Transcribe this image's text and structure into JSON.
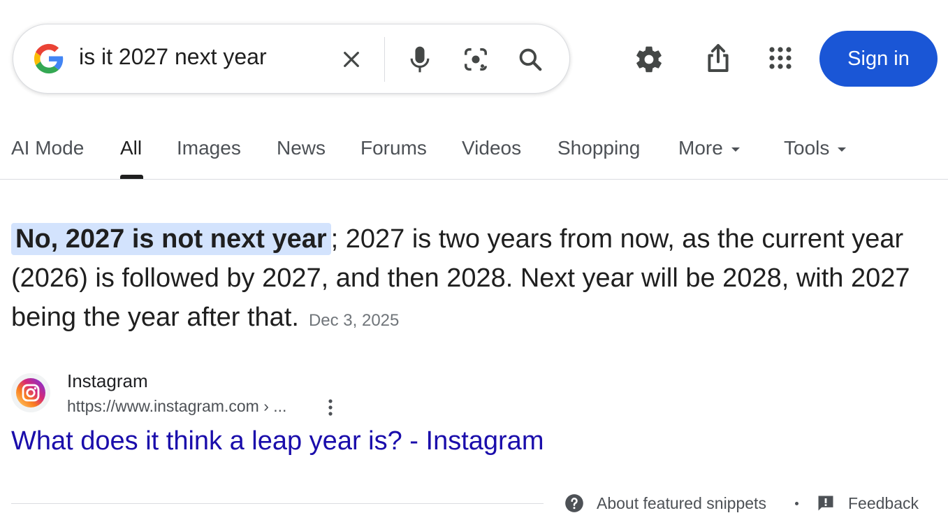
{
  "search": {
    "query": "is it 2027 next year",
    "icons": [
      "google-logo",
      "clear-icon",
      "mic-icon",
      "lens-icon",
      "search-icon"
    ]
  },
  "header": {
    "icons": [
      "gear-icon",
      "share-icon",
      "apps-grid-icon"
    ],
    "sign_in_label": "Sign in",
    "sign_in_color": "#1a56d6"
  },
  "tabs": [
    {
      "label": "AI Mode",
      "active": false
    },
    {
      "label": "All",
      "active": true
    },
    {
      "label": "Images",
      "active": false
    },
    {
      "label": "News",
      "active": false
    },
    {
      "label": "Forums",
      "active": false
    },
    {
      "label": "Videos",
      "active": false
    },
    {
      "label": "Shopping",
      "active": false
    },
    {
      "label": "More",
      "active": false,
      "dropdown": true
    },
    {
      "label": "Tools",
      "active": false,
      "dropdown": true
    }
  ],
  "snippet": {
    "highlight": "No, 2027 is not next year",
    "text": "; 2027 is two years from now, as the current year (2026) is followed by 2027, and then 2028. Next year will be 2028, with 2027 being the year after that.",
    "date": "Dec 3, 2025",
    "highlight_color": "#d3e3fd"
  },
  "source": {
    "name": "Instagram",
    "url": "https://www.instagram.com › ...",
    "title": "What does it think a leap year is? - Instagram",
    "title_color": "#1a0dab",
    "favicon": "instagram-icon"
  },
  "footer": {
    "about_label": "About featured snippets",
    "feedback_label": "Feedback"
  }
}
